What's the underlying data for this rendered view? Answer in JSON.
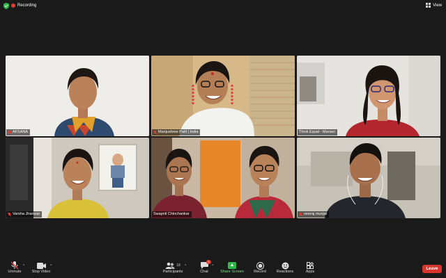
{
  "topbar": {
    "recording_label": "Recording",
    "view_label": "View"
  },
  "participants": [
    {
      "name": "AFSANA",
      "muted": true
    },
    {
      "name": "Manjushree Patil | India",
      "muted": true
    },
    {
      "name": "Think Equal - Manavi",
      "muted": false,
      "active_speaker": true
    },
    {
      "name": "Varsha Jhanwar",
      "muted": true
    },
    {
      "name": "Swapnil Chinchankar",
      "muted": false
    },
    {
      "name": "neeraj munjal",
      "muted": true
    }
  ],
  "toolbar": {
    "unmute": "Unmute",
    "stop_video": "Stop Video",
    "participants": "Participants",
    "participants_count": "18",
    "chat": "Chat",
    "chat_badge": "1",
    "share_screen": "Share Screen",
    "record": "Record",
    "reactions": "Reactions",
    "apps": "Apps",
    "leave": "Leave"
  },
  "colors": {
    "active_speaker": "#33c45a",
    "leave": "#d6342c",
    "share": "#2db84a",
    "recording": "#e23a32"
  }
}
